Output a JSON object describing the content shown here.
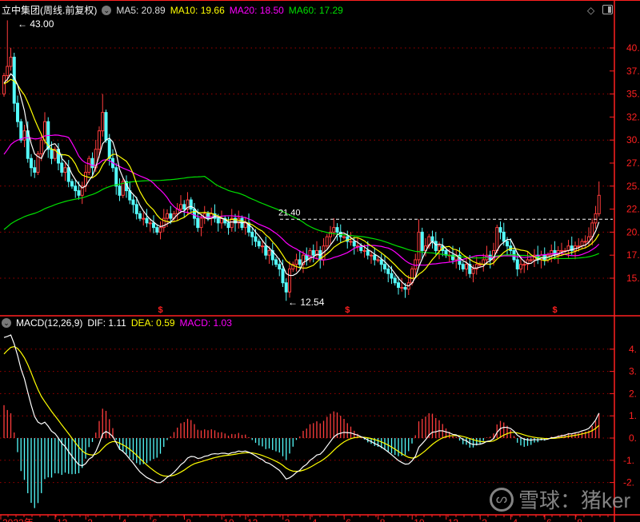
{
  "header": {
    "title": "立中集团(周线.前复权)",
    "ma5": "MA5: 20.89",
    "ma10": "MA10: 19.66",
    "ma20": "MA20: 18.50",
    "ma60": "MA60: 17.29"
  },
  "macd_header": {
    "title": "MACD(12,26,9)",
    "dif": "DIF: 1.11",
    "dea": "DEA: 0.59",
    "macd": "MACD: 1.03"
  },
  "watermark": {
    "text": "雪球：猪ker"
  },
  "colors": {
    "up": "#ff3c3c",
    "down": "#54fcfc",
    "ma5": "#ffffff",
    "ma10": "#ffff00",
    "ma20": "#ff00ff",
    "ma60": "#00e000",
    "axis": "#ff2020"
  },
  "chart_data": [
    {
      "type": "candlestick",
      "title": "立中集团(周线.前复权)",
      "ylim": [
        11,
        44.5
      ],
      "yticks": [
        "40.",
        "37.",
        "35.",
        "32.",
        "30.",
        "27.",
        "25.",
        "22.",
        "20.",
        "17.",
        "15."
      ],
      "ytick_values": [
        40,
        37.5,
        35,
        32.5,
        30,
        27.5,
        25,
        22.5,
        20,
        17.5,
        15
      ],
      "xticks": [
        {
          "label": "2022年",
          "index": 0
        },
        {
          "label": "12",
          "index": 16
        },
        {
          "label": "2",
          "index": 25
        },
        {
          "label": "4",
          "index": 35
        },
        {
          "label": "6",
          "index": 44
        },
        {
          "label": "8",
          "index": 54
        },
        {
          "label": "10",
          "index": 65
        },
        {
          "label": "12",
          "index": 72
        },
        {
          "label": "2",
          "index": 83
        },
        {
          "label": "4",
          "index": 91
        },
        {
          "label": "6",
          "index": 101
        },
        {
          "label": "8",
          "index": 111
        },
        {
          "label": "10",
          "index": 121
        },
        {
          "label": "12",
          "index": 131
        },
        {
          "label": "2",
          "index": 141
        },
        {
          "label": "4",
          "index": 150
        },
        {
          "label": "6",
          "index": 160
        },
        {
          "label": "8",
          "index": 169
        }
      ],
      "closes": [
        37,
        38,
        39,
        34,
        32,
        30,
        31,
        28,
        27,
        26.5,
        28.5,
        30,
        32,
        29,
        28,
        29,
        27.5,
        26.5,
        27,
        25.5,
        25,
        24.5,
        24,
        25,
        26.5,
        28,
        27,
        29,
        31,
        33,
        30,
        28,
        27,
        25,
        24,
        25.5,
        24.5,
        23.5,
        23,
        22,
        21.5,
        21.5,
        21,
        21,
        20.5,
        20,
        20.5,
        21.5,
        22,
        21.5,
        22,
        22.5,
        23,
        22.5,
        23.5,
        22.5,
        21.5,
        20.5,
        21.5,
        22,
        21.5,
        22,
        21.5,
        21,
        21.5,
        21,
        20.5,
        21.5,
        21,
        21.5,
        20.5,
        21,
        20,
        19.5,
        19,
        18.5,
        18.5,
        17.5,
        18,
        17,
        16.5,
        16,
        14.5,
        13.5,
        16,
        16.5,
        17,
        16.5,
        17.5,
        17,
        18,
        17.5,
        18,
        17,
        18.5,
        19.5,
        20,
        20.5,
        20,
        19.5,
        19.5,
        19,
        19,
        18.5,
        18.5,
        18,
        18,
        17.5,
        17.5,
        17,
        17,
        16.5,
        16,
        15.5,
        15,
        14.5,
        14,
        14,
        13.8,
        14.5,
        16,
        17,
        20,
        18,
        18.5,
        19.5,
        19,
        18,
        18.5,
        18,
        17.5,
        17.5,
        17,
        17.5,
        16.5,
        16,
        16.5,
        15.5,
        16,
        16.5,
        16.5,
        17,
        17.5,
        17,
        18,
        20.5,
        20,
        19,
        18.5,
        18,
        17,
        16,
        16.5,
        16.5,
        17,
        17,
        17.5,
        17,
        17.5,
        17,
        17.5,
        18,
        17.5,
        18,
        18,
        18,
        18.5,
        18,
        18.5,
        18.5,
        19,
        19,
        19.5,
        21,
        22,
        24
      ],
      "first_open": 35,
      "extremes": [
        {
          "index": 1,
          "high": 43.0
        },
        {
          "index": 83,
          "low": 12.54
        },
        {
          "index": 122,
          "high": 21.4
        },
        {
          "index": 175,
          "high": 25.5
        },
        {
          "index": 29,
          "high": 35
        }
      ],
      "annotations": {
        "high": "43.00",
        "low": "12.54",
        "level": "21.40",
        "level_value": 21.4
      },
      "dividend_marker": "$",
      "dividend_indices": [
        46,
        101,
        162
      ],
      "ma_padding": {
        "ma5": 36,
        "ma10": 36,
        "ma20": 28,
        "ma60": 20
      },
      "series": [
        {
          "name": "MA5"
        },
        {
          "name": "MA10"
        },
        {
          "name": "MA20"
        },
        {
          "name": "MA60"
        }
      ]
    },
    {
      "type": "macd",
      "title": "MACD(12,26,9)",
      "ylim": [
        -3.3,
        5.5
      ],
      "yticks": [
        "4.",
        "3.",
        "2.",
        "1.",
        "0.",
        "-1.",
        "-2."
      ],
      "ytick_values": [
        4,
        3,
        2,
        1,
        0,
        -1,
        -2
      ],
      "ema_seed": {
        "ema12": 32.5,
        "ema26": 28.0,
        "dea": 3.6
      }
    }
  ]
}
